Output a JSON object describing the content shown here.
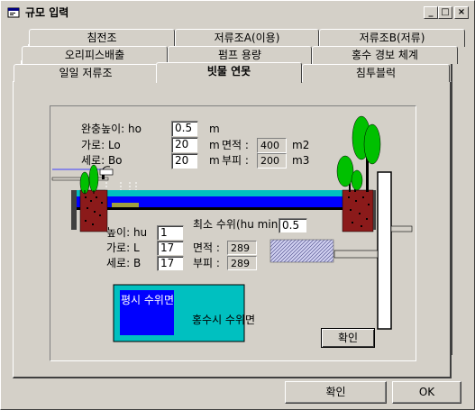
{
  "window": {
    "title": "규모 입력"
  },
  "titlebar_buttons": {
    "minimize": "_",
    "maximize": "□",
    "close": "×"
  },
  "tabs": {
    "row1": [
      "침전조",
      "저류조A(이용)",
      "저류조B(저류)"
    ],
    "row2": [
      "오리피스배출",
      "펌프 용량",
      "홍수 경보 체계"
    ],
    "row3": [
      "일일 저류조",
      "빗물 연못",
      "침투블럭"
    ],
    "active": "빗물 연못"
  },
  "pond": {
    "upper": {
      "ho_label": "완충높이: ho",
      "ho_value": "0.5",
      "ho_unit": "m",
      "lo_label": "가로: Lo",
      "lo_value": "20",
      "lo_unit": "m",
      "area_label": "면적 :",
      "area_value": "400",
      "area_unit": "m2",
      "bo_label": "세로: Bo",
      "bo_value": "20",
      "bo_unit": "m",
      "volume_label": "부피 :",
      "volume_value": "200",
      "volume_unit": "m3"
    },
    "lower": {
      "hu_label": "높이: hu",
      "hu_value": "1",
      "min_level_label": "최소 수위(hu min)",
      "min_level_value": "0.5",
      "l_label": "가로: L",
      "l_value": "17",
      "area_label": "면적 :",
      "area_value": "289",
      "b_label": "세로: B",
      "b_value": "17",
      "volume_label": "부피 :",
      "volume_value": "289"
    },
    "legend": {
      "normal_label": "평시 수위면",
      "flood_label": "홍수시 수위면"
    },
    "confirm_button": "확인"
  },
  "footer": {
    "confirm_button": "확인",
    "ok_button": "OK"
  },
  "colors": {
    "water_blue": "#0000ff",
    "flood_teal": "#00c0c0",
    "cyan": "#00ffff",
    "green": "#00c000",
    "brick": "#8b1a1a",
    "olive": "#808000"
  }
}
